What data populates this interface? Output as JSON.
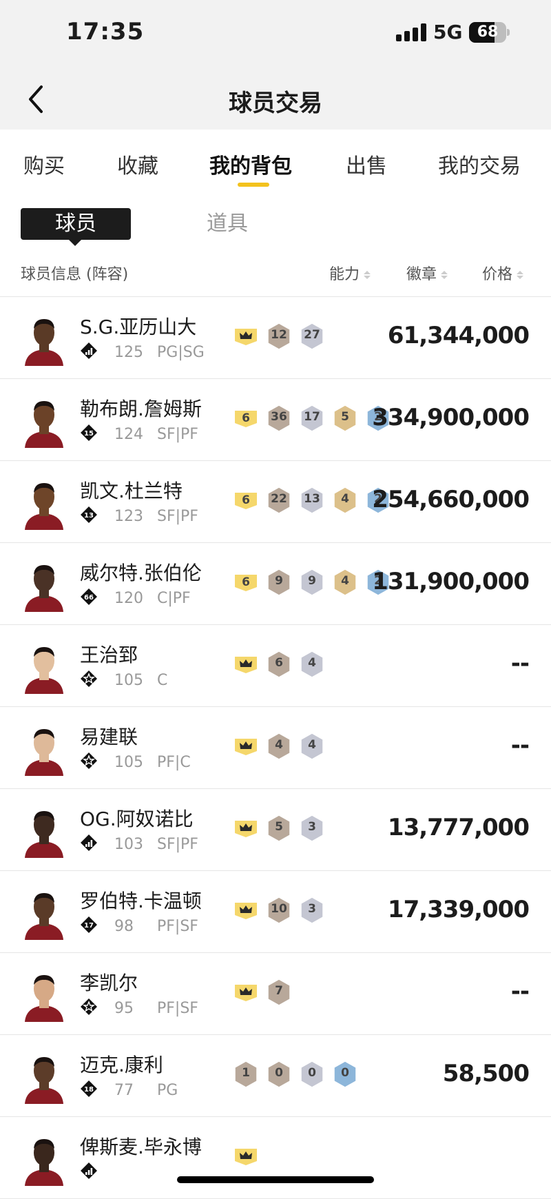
{
  "status_bar": {
    "time": "17:35",
    "network": "5G",
    "battery": "68",
    "battery_level": 0.68
  },
  "nav": {
    "title": "球员交易"
  },
  "tabs": [
    {
      "label": "购买",
      "active": false
    },
    {
      "label": "收藏",
      "active": false
    },
    {
      "label": "我的背包",
      "active": true
    },
    {
      "label": "出售",
      "active": false
    },
    {
      "label": "我的交易",
      "active": false
    }
  ],
  "segments": {
    "active": "球员",
    "inactive": "道具"
  },
  "list_header": {
    "info": "球员信息 (阵容)",
    "ability": "能力",
    "badge": "徽章",
    "price": "价格"
  },
  "badge_colors": {
    "crown": "#f5d76b",
    "number": "#f5d76b",
    "bronze": "#b8a89a",
    "silver": "#c4c6d2",
    "gold": "#dcc08a",
    "blue": "#8db6da"
  },
  "players": [
    {
      "name": "S.G.亚历山大",
      "class": "bars",
      "rating": "125",
      "position": "PG|SG",
      "skin": "#5a3a26",
      "badges": [
        {
          "kind": "crown",
          "text": ""
        },
        {
          "kind": "bronze",
          "text": "12"
        },
        {
          "kind": "silver",
          "text": "27"
        }
      ],
      "price": "61,344,000"
    },
    {
      "name": "勒布朗.詹姆斯",
      "class": "15",
      "rating": "124",
      "position": "SF|PF",
      "skin": "#6b4228",
      "badges": [
        {
          "kind": "number",
          "text": "6"
        },
        {
          "kind": "bronze",
          "text": "36"
        },
        {
          "kind": "silver",
          "text": "17"
        },
        {
          "kind": "gold",
          "text": "5"
        },
        {
          "kind": "blue",
          "text": "2"
        }
      ],
      "price": "334,900,000"
    },
    {
      "name": "凯文.杜兰特",
      "class": "13",
      "rating": "123",
      "position": "SF|PF",
      "skin": "#6e4529",
      "badges": [
        {
          "kind": "number",
          "text": "6"
        },
        {
          "kind": "bronze",
          "text": "22"
        },
        {
          "kind": "silver",
          "text": "13"
        },
        {
          "kind": "gold",
          "text": "4"
        },
        {
          "kind": "blue",
          "text": "2"
        }
      ],
      "price": "254,660,000"
    },
    {
      "name": "威尔特.张伯伦",
      "class": "66",
      "rating": "120",
      "position": "C|PF",
      "skin": "#4a3226",
      "badges": [
        {
          "kind": "number",
          "text": "6"
        },
        {
          "kind": "bronze",
          "text": "9"
        },
        {
          "kind": "silver",
          "text": "9"
        },
        {
          "kind": "gold",
          "text": "4"
        },
        {
          "kind": "blue",
          "text": "2"
        }
      ],
      "price": "131,900,000"
    },
    {
      "name": "王治郅",
      "class": "star",
      "rating": "105",
      "position": "C",
      "skin": "#e2bf9e",
      "badges": [
        {
          "kind": "crown",
          "text": ""
        },
        {
          "kind": "bronze",
          "text": "6"
        },
        {
          "kind": "silver",
          "text": "4"
        }
      ],
      "price": "--"
    },
    {
      "name": "易建联",
      "class": "star",
      "rating": "105",
      "position": "PF|C",
      "skin": "#deb999",
      "badges": [
        {
          "kind": "crown",
          "text": ""
        },
        {
          "kind": "bronze",
          "text": "4"
        },
        {
          "kind": "silver",
          "text": "4"
        }
      ],
      "price": "--"
    },
    {
      "name": "OG.阿奴诺比",
      "class": "bars",
      "rating": "103",
      "position": "SF|PF",
      "skin": "#3e2a20",
      "badges": [
        {
          "kind": "crown",
          "text": ""
        },
        {
          "kind": "bronze",
          "text": "5"
        },
        {
          "kind": "silver",
          "text": "3"
        }
      ],
      "price": "13,777,000"
    },
    {
      "name": "罗伯特.卡温顿",
      "class": "17",
      "rating": "98",
      "position": "PF|SF",
      "skin": "#5a3b28",
      "badges": [
        {
          "kind": "crown",
          "text": ""
        },
        {
          "kind": "bronze",
          "text": "10"
        },
        {
          "kind": "silver",
          "text": "3"
        }
      ],
      "price": "17,339,000"
    },
    {
      "name": "李凯尔",
      "class": "star",
      "rating": "95",
      "position": "PF|SF",
      "skin": "#d6a986",
      "badges": [
        {
          "kind": "crown",
          "text": ""
        },
        {
          "kind": "bronze",
          "text": "7"
        }
      ],
      "price": "--"
    },
    {
      "name": "迈克.康利",
      "class": "18",
      "rating": "77",
      "position": "PG",
      "skin": "#5c3c29",
      "badges": [
        {
          "kind": "bronze",
          "text": "1"
        },
        {
          "kind": "bronze",
          "text": "0"
        },
        {
          "kind": "silver",
          "text": "0"
        },
        {
          "kind": "blue",
          "text": "0"
        }
      ],
      "price": "58,500"
    },
    {
      "name": "俾斯麦.毕永博",
      "class": "bars",
      "rating": "",
      "position": "",
      "skin": "#3a271d",
      "badges": [
        {
          "kind": "crown",
          "text": ""
        }
      ],
      "price": ""
    }
  ]
}
